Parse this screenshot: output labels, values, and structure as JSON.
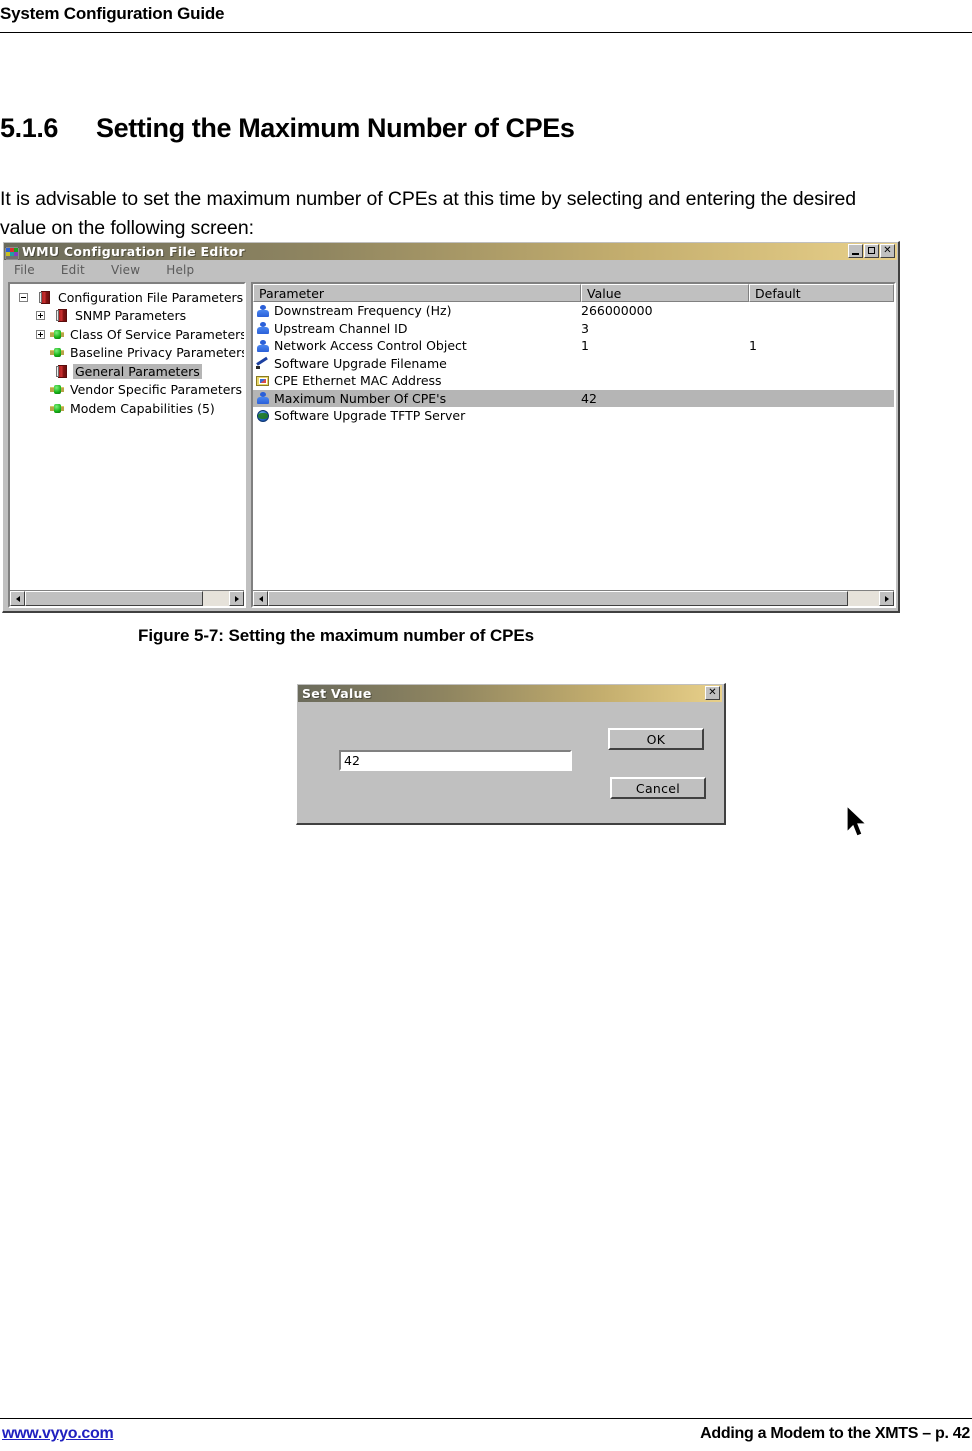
{
  "document": {
    "header_title": "System Configuration Guide",
    "section_number": "5.1.6",
    "section_title": "Setting the Maximum Number of CPEs",
    "body_paragraph": "It is advisable to set the maximum number of CPEs at this time by selecting and entering the desired value on the following screen:",
    "figure_caption": "Figure 5-7: Setting the maximum number of CPEs",
    "footer_left": "www.vyyo.com",
    "footer_right": "Adding a Modem to the XMTS – p. 42"
  },
  "app_window": {
    "title": "WMU Configuration File Editor",
    "title_icon": "app-window-icon",
    "window_controls": {
      "minimize": "_",
      "maximize": "□",
      "close": "✕"
    },
    "menu": [
      {
        "label": "File"
      },
      {
        "label": "Edit"
      },
      {
        "label": "View"
      },
      {
        "label": "Help"
      }
    ],
    "tree": {
      "items": [
        {
          "label": "Configuration File Parameters",
          "depth": 0,
          "expander": "minus",
          "icon": "red-book-icon",
          "selected": false
        },
        {
          "label": "SNMP Parameters",
          "depth": 1,
          "expander": "plus",
          "icon": "red-book-icon",
          "selected": false
        },
        {
          "label": "Class Of Service Parameters",
          "depth": 1,
          "expander": "plus",
          "icon": "green-node-icon",
          "selected": false
        },
        {
          "label": "Baseline Privacy Parameters",
          "depth": 1,
          "expander": "none",
          "icon": "green-node-icon",
          "selected": false
        },
        {
          "label": "General Parameters",
          "depth": 1,
          "expander": "none",
          "icon": "red-book-icon",
          "selected": true
        },
        {
          "label": "Vendor Specific Parameters (",
          "depth": 1,
          "expander": "none",
          "icon": "green-node-icon",
          "selected": false
        },
        {
          "label": "Modem Capabilities (5)",
          "depth": 1,
          "expander": "none",
          "icon": "green-node-icon",
          "selected": false
        }
      ]
    },
    "list_view": {
      "columns": [
        "Parameter",
        "Value",
        "Default"
      ],
      "rows": [
        {
          "name": "Downstream Frequency  (Hz)",
          "value": "266000000",
          "default": "",
          "icon": "person-icon",
          "selected": false
        },
        {
          "name": "Upstream Channel ID",
          "value": "3",
          "default": "",
          "icon": "person-icon",
          "selected": false
        },
        {
          "name": "Network Access Control Object",
          "value": "1",
          "default": "1",
          "icon": "person-icon",
          "selected": false
        },
        {
          "name": "Software Upgrade Filename",
          "value": "",
          "default": "",
          "icon": "pencil-icon",
          "selected": false
        },
        {
          "name": "CPE Ethernet MAC Address",
          "value": "",
          "default": "",
          "icon": "folder-picture-icon",
          "selected": false
        },
        {
          "name": "Maximum Number Of CPE's",
          "value": "42",
          "default": "",
          "icon": "person-icon",
          "selected": true
        },
        {
          "name": "Software Upgrade TFTP Server",
          "value": "",
          "default": "",
          "icon": "globe-icon",
          "selected": false
        }
      ]
    }
  },
  "dialog": {
    "title": "Set Value",
    "close_label": "✕",
    "input_value": "42",
    "input_placeholder": "",
    "ok_label": "OK",
    "cancel_label": "Cancel"
  },
  "colors": {
    "titlebar_start": "#6b6b5c",
    "titlebar_end": "#e8d08a",
    "window_face": "#c0c0c0",
    "selection": "#b5b5b5",
    "link": "#2020c0"
  }
}
